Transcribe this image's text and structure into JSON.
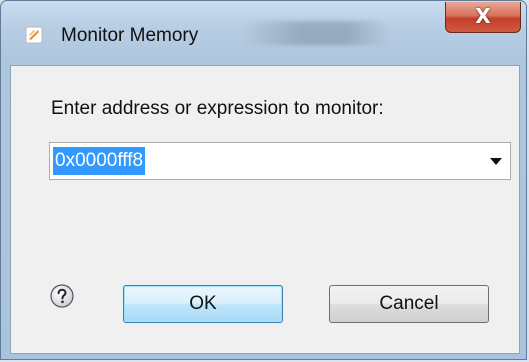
{
  "window": {
    "title": "Monitor Memory",
    "close_glyph": "X"
  },
  "dialog": {
    "prompt": "Enter address or expression to monitor:",
    "expression_value": "0x0000fff8",
    "ok_label": "OK",
    "cancel_label": "Cancel"
  },
  "icons": {
    "app": "eclipse-app-icon",
    "help": "help-icon",
    "dropdown": "chevron-down-icon",
    "close": "close-icon"
  },
  "colors": {
    "selection": "#3399ff",
    "close_button": "#c2402a",
    "default_button_border": "#3c7fb1"
  }
}
